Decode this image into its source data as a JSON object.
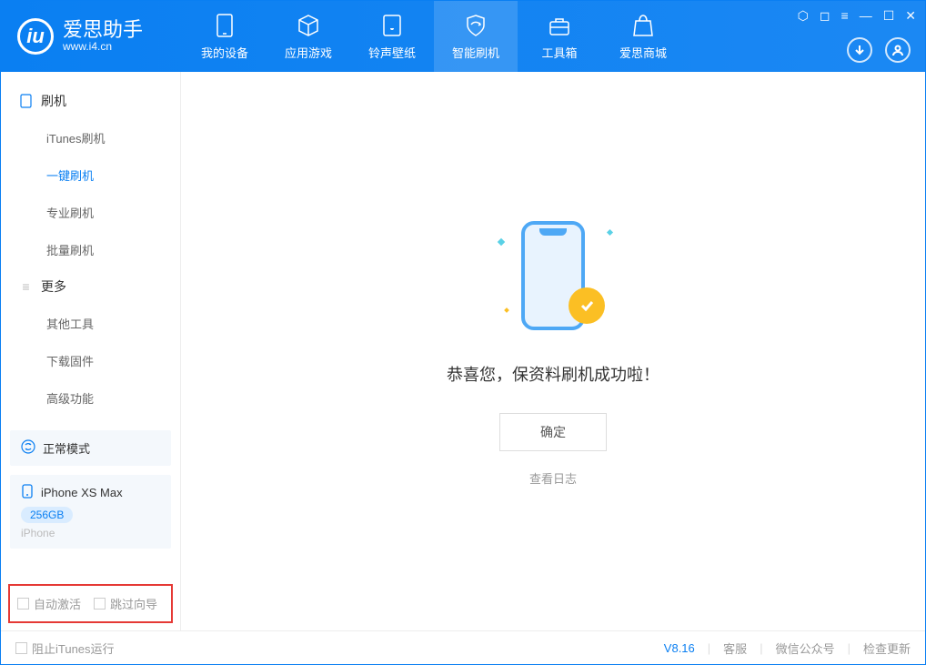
{
  "app": {
    "name": "爱思助手",
    "url": "www.i4.cn"
  },
  "tabs": [
    {
      "label": "我的设备",
      "icon": "device"
    },
    {
      "label": "应用游戏",
      "icon": "cube"
    },
    {
      "label": "铃声壁纸",
      "icon": "music"
    },
    {
      "label": "智能刷机",
      "icon": "shield",
      "active": true
    },
    {
      "label": "工具箱",
      "icon": "toolbox"
    },
    {
      "label": "爱思商城",
      "icon": "bag"
    }
  ],
  "sidebar": {
    "group1": {
      "title": "刷机"
    },
    "items1": [
      {
        "label": "iTunes刷机"
      },
      {
        "label": "一键刷机",
        "active": true
      },
      {
        "label": "专业刷机"
      },
      {
        "label": "批量刷机"
      }
    ],
    "group2": {
      "title": "更多"
    },
    "items2": [
      {
        "label": "其他工具"
      },
      {
        "label": "下载固件"
      },
      {
        "label": "高级功能"
      }
    ],
    "mode_card": {
      "label": "正常模式"
    },
    "device_card": {
      "name": "iPhone XS Max",
      "capacity": "256GB",
      "type": "iPhone"
    },
    "checkboxes": {
      "auto_activate": "自动激活",
      "skip_guide": "跳过向导"
    }
  },
  "main": {
    "success_message": "恭喜您，保资料刷机成功啦！",
    "ok_button": "确定",
    "view_log": "查看日志"
  },
  "footer": {
    "stop_itunes": "阻止iTunes运行",
    "version": "V8.16",
    "support": "客服",
    "wechat": "微信公众号",
    "check_update": "检查更新"
  }
}
